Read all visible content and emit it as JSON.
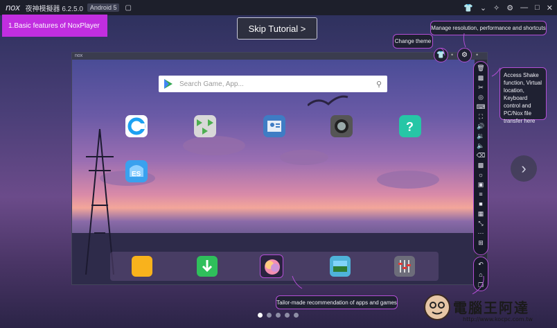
{
  "titlebar": {
    "logo": "nox",
    "app_title": "夜神模擬器 6.2.5.0",
    "android_badge": "Android 5",
    "right_icons": [
      "shirt-icon",
      "chevron-down-icon",
      "globe-icon",
      "gear-icon",
      "minimize-icon",
      "maximize-icon",
      "close-icon"
    ]
  },
  "tutorial": {
    "feature_label": "1.Basic features of NoxPlayer",
    "skip_label": "Skip Tutorial >",
    "change_theme": "Change theme",
    "manage_res": "Manage resolution, performance and shortcuts",
    "shake_info": "Access Shake function, Virtual location, Keyboard control and PC/Nox file transfer here",
    "tailor_made": "Tailor-made recommendation of apps and games",
    "page_count": 5,
    "active_page": 1
  },
  "emulator": {
    "frame_title": "nox",
    "search_placeholder": "Search Game, App...",
    "home_icons": [
      "c-browser-icon",
      "media-player-icon",
      "contacts-icon",
      "camera-icon",
      "help-icon",
      "es-file-explorer-icon"
    ],
    "dock_icons": [
      "folder-icon",
      "download-store-icon",
      "recommend-icon",
      "gallery-icon",
      "settings-mixer-icon"
    ]
  },
  "sidebar": {
    "icons": [
      "trash-icon",
      "apk-icon",
      "scissors-icon",
      "location-icon",
      "keyboard-icon",
      "fullscreen-icon",
      "volume-up-icon",
      "volume-down-icon",
      "volume-mute-icon",
      "clear-icon",
      "multi-drive-icon",
      "brightness-icon",
      "screenshot-icon",
      "shake-icon",
      "record-icon",
      "macro-icon",
      "resize-icon",
      "more-icon",
      "import-icon"
    ],
    "nav_icons": [
      "back-icon",
      "home-icon",
      "recent-apps-icon"
    ]
  },
  "watermark": {
    "text": "電腦王阿達",
    "url": "http://www.kocpc.com.tw"
  },
  "colors": {
    "accent": "#c12ee0",
    "border": "#b44fd6",
    "titlebar": "#1d1f2b"
  }
}
